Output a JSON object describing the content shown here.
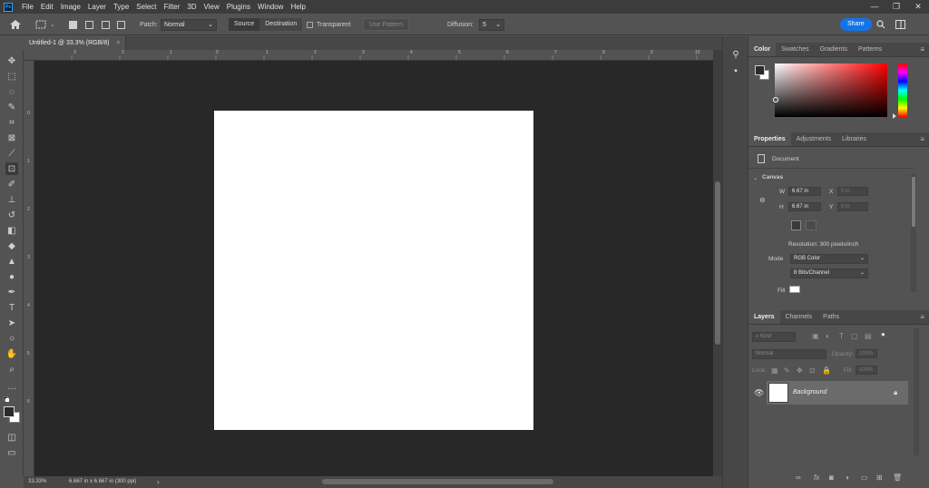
{
  "app": {
    "logo_text": "Ps"
  },
  "menu": [
    "File",
    "Edit",
    "Image",
    "Layer",
    "Type",
    "Select",
    "Filter",
    "3D",
    "View",
    "Plugins",
    "Window",
    "Help"
  ],
  "window_controls": {
    "minimize": "—",
    "restore": "❐",
    "close": "✕"
  },
  "options": {
    "patch_label": "Patch:",
    "patch_value": "Normal",
    "source_label": "Source",
    "destination_label": "Destination",
    "transparent_label": "Transparent",
    "use_pattern_label": "Use Pattern",
    "diffusion_label": "Diffusion:",
    "diffusion_value": "5",
    "share_label": "Share"
  },
  "document": {
    "tab_title": "Untitled-1 @ 33.3% (RGB/8)",
    "tab_close": "×"
  },
  "ruler": {
    "top_ticks": [
      "4",
      "3",
      "2",
      "1",
      "0",
      "1",
      "2",
      "3",
      "4",
      "5",
      "6",
      "7",
      "8",
      "9",
      "10"
    ],
    "left_ticks": [
      "0",
      "1",
      "2",
      "3",
      "4",
      "5",
      "6"
    ]
  },
  "status": {
    "zoom": "33.33%",
    "doc_info": "6.667 in x 6.667 in (300 ppi)",
    "arrow": "›"
  },
  "color_panel": {
    "tabs": [
      "Color",
      "Swatches",
      "Gradients",
      "Patterns"
    ],
    "active_tab": "Color"
  },
  "properties_panel": {
    "tabs": [
      "Properties",
      "Adjustments",
      "Libraries"
    ],
    "active_tab": "Properties",
    "type_label": "Document",
    "section_label": "Canvas",
    "w_label": "W",
    "w_value": "6.67 in",
    "h_label": "H",
    "h_value": "6.67 in",
    "x_label": "X",
    "x_value": "0 in",
    "y_label": "Y",
    "y_value": "0 in",
    "resolution_text": "Resolution: 300 pixels/inch",
    "mode_label": "Mode",
    "mode_value": "RGB Color",
    "bits_value": "8 Bits/Channel",
    "fill_label": "Fill"
  },
  "layers_panel": {
    "tabs": [
      "Layers",
      "Channels",
      "Paths"
    ],
    "active_tab": "Layers",
    "kind_placeholder": "Kind",
    "blend_mode": "Normal",
    "opacity_label": "Opacity:",
    "opacity_value": "100%",
    "lock_label": "Lock:",
    "fill_label": "Fill:",
    "fill_value": "100%",
    "layers": [
      {
        "name": "Background",
        "visible": true,
        "locked": true
      }
    ]
  },
  "colors": {
    "accent": "#1473e6",
    "canvas_bg": "#282828",
    "panel_bg": "#535353",
    "picker_hue": "#ff0000"
  }
}
